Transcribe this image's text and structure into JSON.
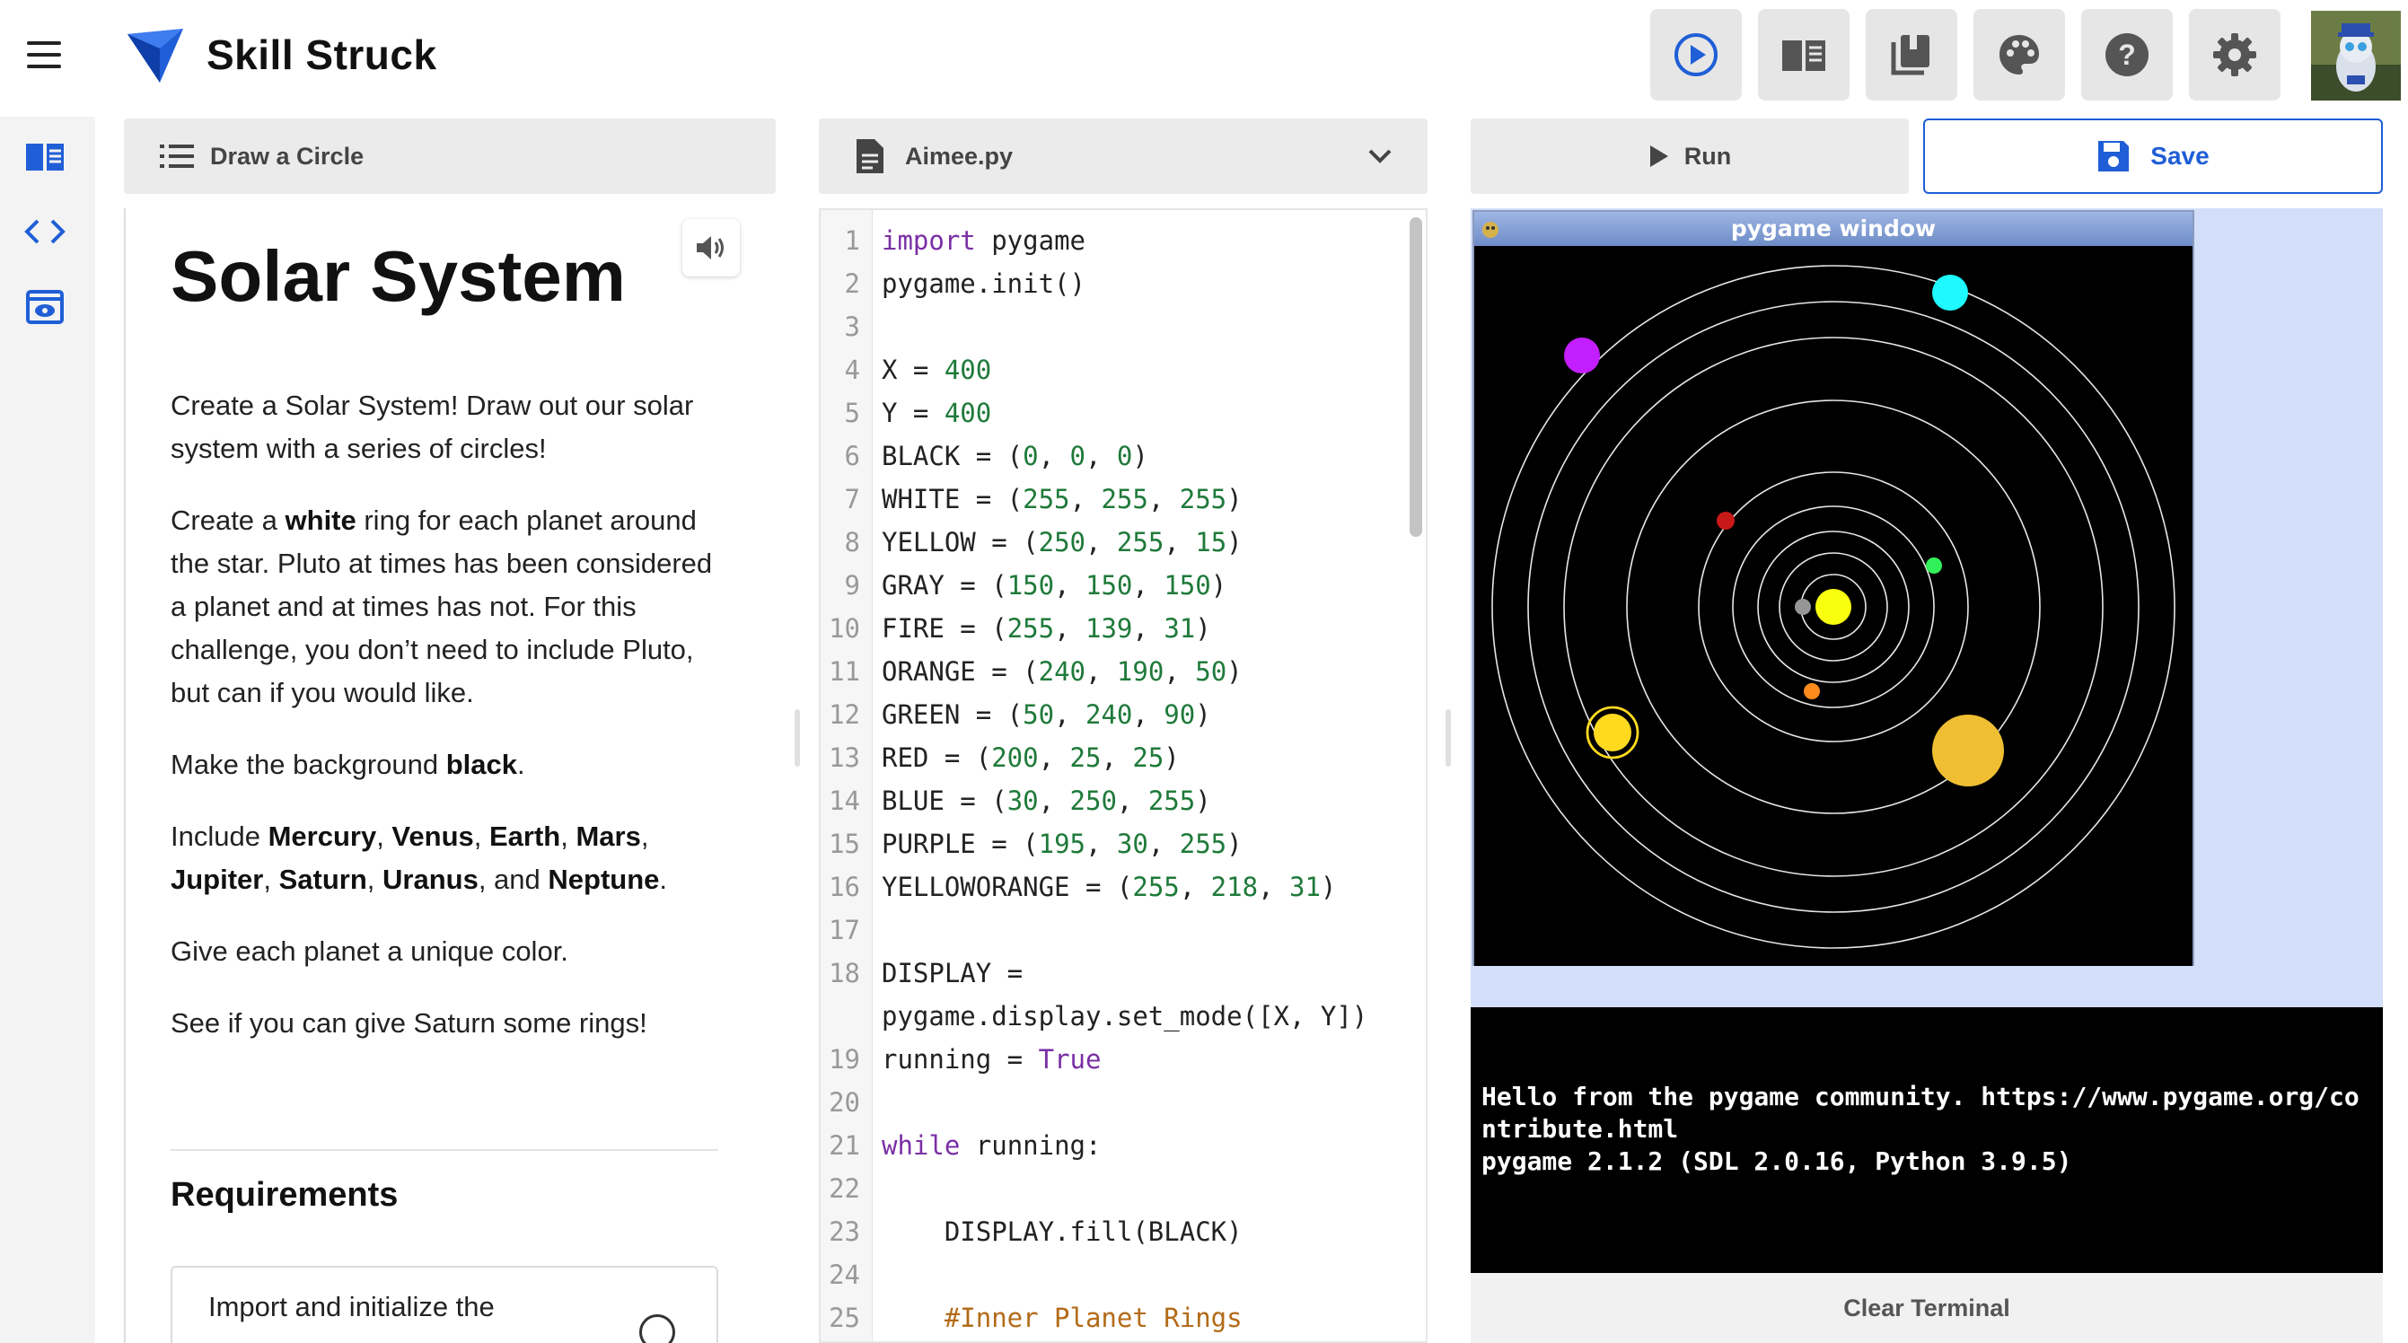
{
  "app": {
    "brand": "Skill Struck"
  },
  "toolbar": {
    "icons": [
      "play-circle-icon",
      "book-open-icon",
      "library-icon",
      "palette-icon",
      "help-icon",
      "settings-icon"
    ],
    "accent": "#1f5ed6"
  },
  "sidebar": {
    "icons": [
      "instructions-book-icon",
      "code-icon",
      "preview-icon"
    ]
  },
  "instructions": {
    "header": "Draw a Circle",
    "title": "Solar System",
    "p1": "Create a Solar System! Draw out our solar system with a series of circles!",
    "p2_a": "Create a ",
    "p2_b": "white",
    "p2_c": " ring for each planet around the star. Pluto at times has been considered a planet and at times has not. For this challenge, you don’t need to include Pluto, but can if you would like.",
    "p3_a": "Make the background ",
    "p3_b": "black",
    "p3_c": ".",
    "p4_a": "Include ",
    "planets": [
      "Mercury",
      "Venus",
      "Earth",
      "Mars",
      "Jupiter",
      "Saturn",
      "Uranus",
      "Neptune"
    ],
    "sep_comma": ", ",
    "sep_and": ", and ",
    "p4_end": ".",
    "p5": "Give each planet a unique color.",
    "p6": "See if you can give Saturn some rings!",
    "requirements_title": "Requirements",
    "requirement_1": "Import and initialize the"
  },
  "editor": {
    "filename": "Aimee.py",
    "lines": [
      {
        "n": "1",
        "code": "import pygame"
      },
      {
        "n": "2",
        "code": "pygame.init()"
      },
      {
        "n": "3",
        "code": ""
      },
      {
        "n": "4",
        "code": "X = 400"
      },
      {
        "n": "5",
        "code": "Y = 400"
      },
      {
        "n": "6",
        "code": "BLACK = (0, 0, 0)"
      },
      {
        "n": "7",
        "code": "WHITE = (255, 255, 255)"
      },
      {
        "n": "8",
        "code": "YELLOW = (250, 255, 15)"
      },
      {
        "n": "9",
        "code": "GRAY = (150, 150, 150)"
      },
      {
        "n": "10",
        "code": "FIRE = (255, 139, 31)"
      },
      {
        "n": "11",
        "code": "ORANGE = (240, 190, 50)"
      },
      {
        "n": "12",
        "code": "GREEN = (50, 240, 90)"
      },
      {
        "n": "13",
        "code": "RED = (200, 25, 25)"
      },
      {
        "n": "14",
        "code": "BLUE = (30, 250, 255)"
      },
      {
        "n": "15",
        "code": "PURPLE = (195, 30, 255)"
      },
      {
        "n": "16",
        "code": "YELLOWORANGE = (255, 218, 31)"
      },
      {
        "n": "17",
        "code": ""
      },
      {
        "n": "18",
        "code": "DISPLAY ="
      },
      {
        "n": "",
        "code": "pygame.display.set_mode([X, Y])"
      },
      {
        "n": "19",
        "code": "running = True"
      },
      {
        "n": "20",
        "code": ""
      },
      {
        "n": "21",
        "code": "while running:"
      },
      {
        "n": "22",
        "code": ""
      },
      {
        "n": "23",
        "code": "    DISPLAY.fill(BLACK)"
      },
      {
        "n": "24",
        "code": ""
      },
      {
        "n": "25",
        "code": "    #Inner Planet Rings"
      }
    ]
  },
  "output": {
    "run_label": "Run",
    "save_label": "Save",
    "window_title": "pygame window",
    "terminal": "Hello from the pygame community. https://www.pygame.org/contribute.html\npygame 2.1.2 (SDL 2.0.16, Python 3.9.5)",
    "clear_label": "Clear Terminal"
  }
}
